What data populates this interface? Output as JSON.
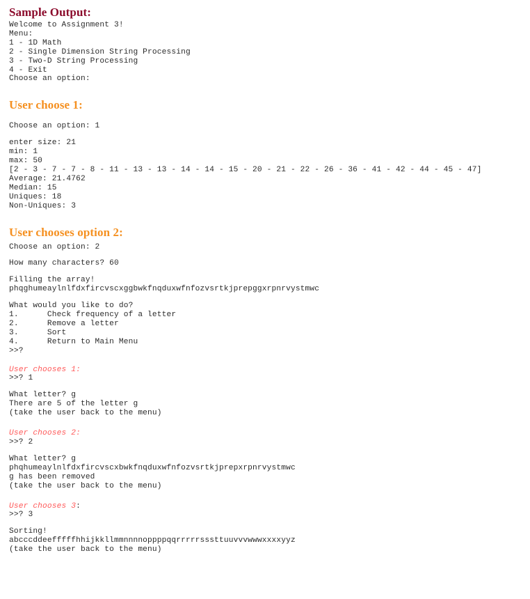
{
  "sections": {
    "sample_output": {
      "heading": "Sample Output:",
      "console": "Welcome to Assignment 3!\nMenu:\n1 - 1D Math\n2 - Single Dimension String Processing\n3 - Two-D String Processing\n4 - Exit\nChoose an option:"
    },
    "user_choose_1": {
      "heading": "User choose 1:",
      "prompt_line": "Choose an option: 1",
      "console": "enter size: 21\nmin: 1\nmax: 50\n[2 - 3 - 7 - 7 - 8 - 11 - 13 - 13 - 14 - 14 - 15 - 20 - 21 - 22 - 26 - 36 - 41 - 42 - 44 - 45 - 47]\nAverage: 21.4762\nMedian: 15\nUniques: 18\nNon-Uniques: 3"
    },
    "user_chooses_option_2": {
      "heading": "User chooses option 2:",
      "prompt_line": "Choose an option: 2",
      "chars_line": "How many characters? 60",
      "fill_block": "Filling the array!\nphqghumeaylnlfdxfircvscxggbwkfnqduxwfnfozvsrtkjprepggxrpnrvystmwc",
      "menu_block": "What would you like to do?\n1.      Check frequency of a letter\n2.      Remove a letter\n3.      Sort\n4.      Return to Main Menu\n>>?",
      "sub_1": {
        "label": "User chooses 1:",
        "label_tail": "",
        "input_line": ">>? 1",
        "output_block": "What letter? g\nThere are 5 of the letter g\n(take the user back to the menu)"
      },
      "sub_2": {
        "label": "User chooses 2:",
        "label_tail": "",
        "input_line": ">>? 2",
        "output_block": "What letter? g\nphqhumeaylnlfdxfircvscxbwkfnqduxwfnfozvsrtkjprepxrpnrvystmwc\ng has been removed\n(take the user back to the menu)"
      },
      "sub_3": {
        "label": "User chooses 3",
        "label_tail": ":",
        "input_line": ">>? 3",
        "output_block": "Sorting!\nabcccddeefffffhhijkkllmmnnnnoppppqqrrrrrsssttuuvvvwwwxxxxyyz\n(take the user back to the menu)"
      }
    }
  },
  "colors": {
    "heading_maroon": "#8b0a2b",
    "heading_orange": "#f59020",
    "console_text": "#2b2b2b",
    "sub_label_red": "#ff5a5a",
    "background": "#ffffff"
  }
}
